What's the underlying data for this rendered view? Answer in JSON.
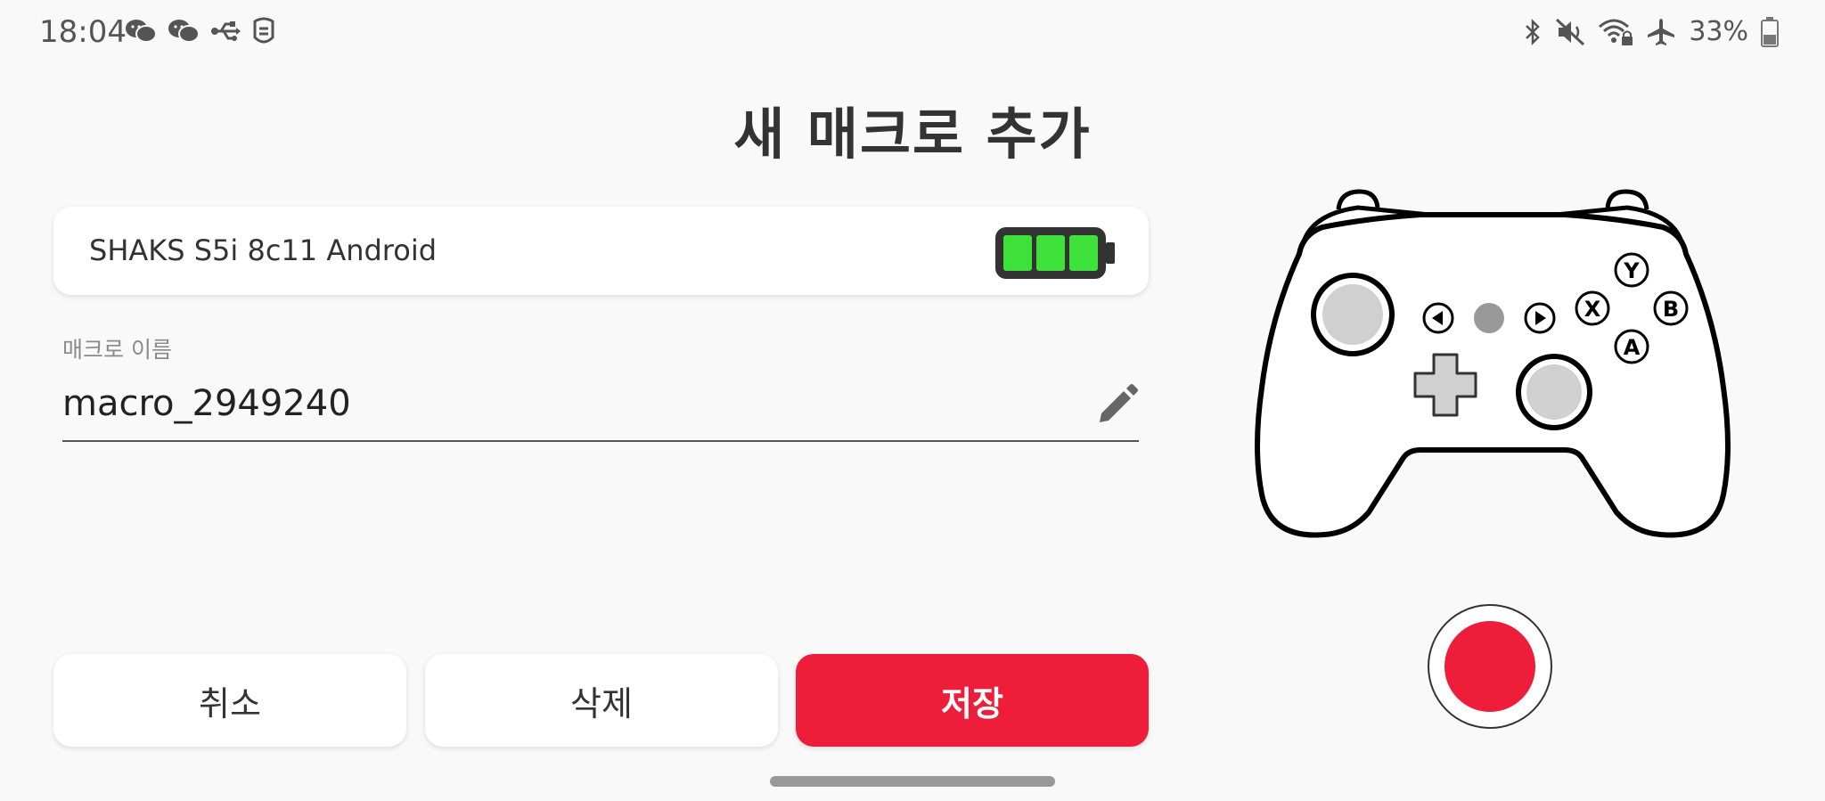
{
  "status_bar": {
    "time": "18:04",
    "battery_percent": "33%",
    "left_icons": [
      "wechat-icon",
      "wechat-icon",
      "usb-icon",
      "notification-app-icon"
    ],
    "right_icons": [
      "bluetooth-icon",
      "vibrate-mute-icon",
      "wifi-lock-icon",
      "airplane-icon",
      "battery-icon"
    ]
  },
  "title": "새 매크로 추가",
  "device": {
    "name": "SHAKS S5i 8c11 Android",
    "battery_level": 1.0,
    "battery_color": "#3ee13a"
  },
  "macro_name": {
    "label": "매크로 이름",
    "value": "macro_2949240"
  },
  "buttons": {
    "cancel": "취소",
    "delete": "삭제",
    "save": "저장"
  },
  "controller": {
    "face_buttons": [
      "Y",
      "B",
      "X",
      "A"
    ]
  },
  "colors": {
    "accent": "#ee1e3a",
    "background": "#f9f9f9"
  }
}
